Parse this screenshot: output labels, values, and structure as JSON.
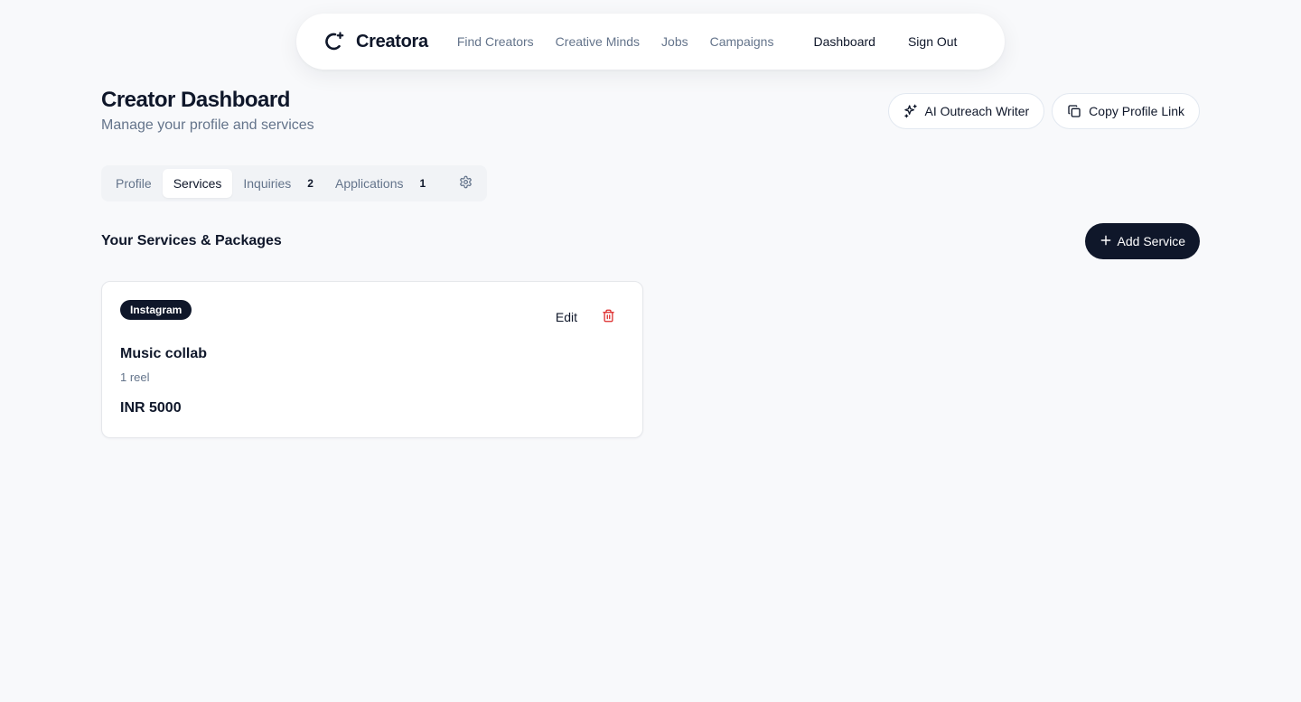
{
  "nav": {
    "brand": "Creatora",
    "links": [
      "Find Creators",
      "Creative Minds",
      "Jobs",
      "Campaigns"
    ],
    "dashboard": "Dashboard",
    "sign_out": "Sign Out"
  },
  "header": {
    "title": "Creator Dashboard",
    "subtitle": "Manage your profile and services",
    "ai_writer_label": "AI Outreach Writer",
    "copy_link_label": "Copy Profile Link"
  },
  "tabs": [
    {
      "label": "Profile",
      "badge": "",
      "active": false
    },
    {
      "label": "Services",
      "badge": "",
      "active": true
    },
    {
      "label": "Inquiries",
      "badge": "2",
      "active": false
    },
    {
      "label": "Applications",
      "badge": "1",
      "active": false
    }
  ],
  "tab_settings_icon": "gear-icon",
  "services_section": {
    "title": "Your Services & Packages",
    "add_label": "Add Service"
  },
  "services": [
    {
      "platform": "Instagram",
      "name": "Music collab",
      "description": "1 reel",
      "price": "INR 5000",
      "edit_label": "Edit"
    }
  ],
  "colors": {
    "background": "#f8f9fb",
    "primary": "#0f172a",
    "muted_text": "#64748b",
    "danger": "#dc2626"
  }
}
